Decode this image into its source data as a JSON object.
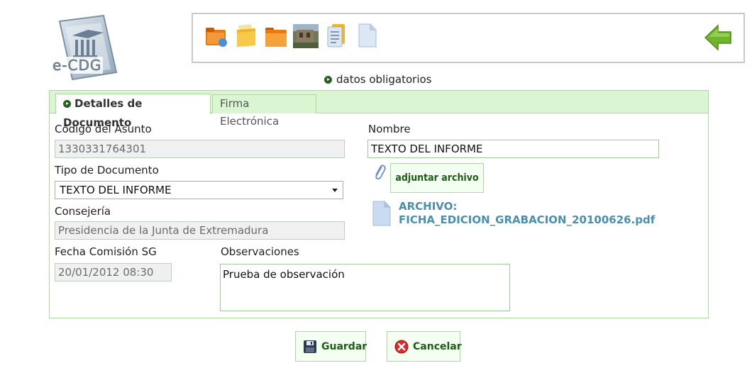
{
  "app": {
    "logo_text": "e-CDG"
  },
  "toolbar": {
    "tools": [
      {
        "icon": "folder-shared-icon"
      },
      {
        "icon": "folders-icon"
      },
      {
        "icon": "folder-icon"
      },
      {
        "icon": "photo-icon"
      },
      {
        "icon": "document-list-icon"
      },
      {
        "icon": "blank-document-icon"
      }
    ],
    "back_icon": "back-arrow-icon"
  },
  "required_note": "datos obligatorios",
  "tabs": [
    {
      "label": "Detalles de Documento",
      "active": true
    },
    {
      "label": "Firma Electrónica",
      "active": false
    }
  ],
  "form": {
    "codigo": {
      "label": "Código del Asunto",
      "value": "1330331764301"
    },
    "tipo": {
      "label": "Tipo de Documento",
      "value": "TEXTO DEL INFORME"
    },
    "consejeria": {
      "label": "Consejería",
      "value": "Presidencia de la Junta de Extremadura"
    },
    "fecha": {
      "label": "Fecha Comisión SG",
      "value": "20/01/2012 08:30"
    },
    "observaciones": {
      "label": "Observaciones",
      "value": "Prueba de observación"
    },
    "nombre": {
      "label": "Nombre",
      "value": "TEXTO DEL INFORME"
    },
    "attach_label": "adjuntar archivo",
    "archivo_label": "ARCHIVO:",
    "archivo_name": "FICHA_EDICION_GRABACION_20100626.pdf"
  },
  "buttons": {
    "save": "Guardar",
    "cancel": "Cancelar"
  },
  "colors": {
    "accent_green": "#24631c",
    "tab_bg": "#d9f5d2",
    "border_green": "#a9dba0",
    "file_link": "#4a8fb0"
  }
}
